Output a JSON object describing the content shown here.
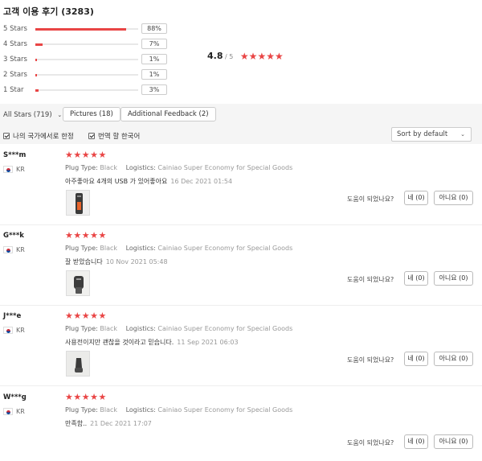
{
  "header": {
    "title": "고객 이용 후기 (3283)"
  },
  "distribution": [
    {
      "label": "5 Stars",
      "pct": "88%",
      "fraction": 0.88
    },
    {
      "label": "4 Stars",
      "pct": "7%",
      "fraction": 0.07
    },
    {
      "label": "3 Stars",
      "pct": "1%",
      "fraction": 0.01
    },
    {
      "label": "2 Stars",
      "pct": "1%",
      "fraction": 0.01
    },
    {
      "label": "1 Star",
      "pct": "3%",
      "fraction": 0.03
    }
  ],
  "average": {
    "value": "4.8",
    "out_of": "/ 5",
    "stars": "★★★★★"
  },
  "filters": {
    "all_stars": "All Stars (719)",
    "pictures": "Pictures (18)",
    "additional_feedback": "Additional Feedback (2)",
    "my_country": "나의 국가에서로 한정",
    "translate": "번역 할 한국어",
    "sort": "Sort by default"
  },
  "labels": {
    "plug_type": "Plug Type:",
    "logistics": "Logistics:",
    "helpful": "도움이 되었나요?",
    "stars": "★★★★★"
  },
  "reviews": [
    {
      "name": "S***m",
      "country": "KR",
      "plug_type": "Black",
      "logistics": "Cainiao Super Economy for Special Goods",
      "text": "아주좋아요 4개의 USB 가 있어좋아요",
      "date": "16 Dec 2021 01:54",
      "yes": "네 (0)",
      "no": "아니요 (0)",
      "has_photo": true
    },
    {
      "name": "G***k",
      "country": "KR",
      "plug_type": "Black",
      "logistics": "Cainiao Super Economy for Special Goods",
      "text": "잘 받았습니다",
      "date": "10 Nov 2021 05:48",
      "yes": "네 (0)",
      "no": "아니요 (0)",
      "has_photo": true
    },
    {
      "name": "J***e",
      "country": "KR",
      "plug_type": "Black",
      "logistics": "Cainiao Super Economy for Special Goods",
      "text": "사용전이지만 괜찮을 것이라고 믿습니다.",
      "date": "11 Sep 2021 06:03",
      "yes": "네 (0)",
      "no": "아니요 (0)",
      "has_photo": true
    },
    {
      "name": "W***g",
      "country": "KR",
      "plug_type": "Black",
      "logistics": "Cainiao Super Economy for Special Goods",
      "text": "만족함..",
      "date": "21 Dec 2021 17:07",
      "yes": "네 (0)",
      "no": "아니요 (0)",
      "has_photo": false
    }
  ],
  "colors": {
    "accent": "#e94545",
    "muted": "#999999",
    "bar_track": "#e8e8e8"
  }
}
